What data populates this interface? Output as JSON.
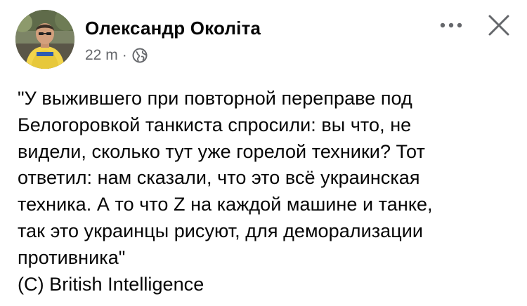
{
  "author": {
    "name": "Олександр Околіта",
    "avatar_icon": "profile-photo"
  },
  "meta": {
    "time": "22 m",
    "separator": "·",
    "audience_icon": "globe-icon"
  },
  "actions": {
    "more_icon": "more-icon",
    "close_icon": "close-icon"
  },
  "post": {
    "lines": [
      "\"У выжившего при повторной переправе под",
      "Белогоровкой танкиста спросили: вы что, не",
      "видели, сколько тут уже горелой техники? Тот",
      "ответил: нам сказали, что это всё украинская",
      "техника. А то что Z на каждой машине и танке,",
      "так это украинцы рисуют, для деморализации",
      "противника\"",
      "(С) British Intelligence"
    ]
  },
  "colors": {
    "text": "#050505",
    "secondary_text": "#65676b"
  }
}
